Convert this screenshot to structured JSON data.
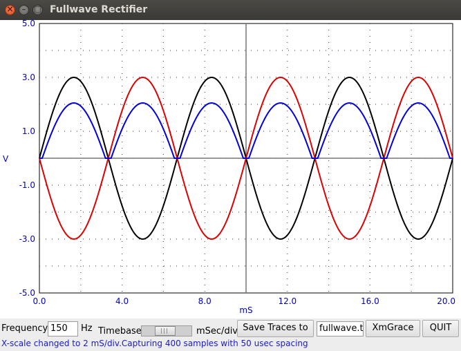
{
  "window": {
    "title": "Fullwave Rectifier",
    "close_glyph": "×",
    "min_glyph": "–",
    "max_glyph": "□"
  },
  "chart_data": {
    "type": "line",
    "xlabel": "mS",
    "ylabel": "V",
    "xlim": [
      0,
      20
    ],
    "ylim": [
      -5,
      5
    ],
    "x_ticks": [
      "0.0",
      "4.0",
      "8.0",
      "12.0",
      "16.0",
      "20.0"
    ],
    "y_ticks": [
      "5.0",
      "3.0",
      "1.0",
      "-1.0",
      "-3.0",
      "-5.0"
    ],
    "grid": "dotted",
    "frequency_hz": 150,
    "series": [
      {
        "color": "#000000",
        "amplitude": 3.0,
        "shape": "sine",
        "period_ms": 6.667
      },
      {
        "color": "#dd0000",
        "amplitude": -3.0,
        "shape": "sine",
        "period_ms": 6.667
      },
      {
        "color": "#0000dd",
        "amplitude": 2.35,
        "shape": "rectified",
        "period_ms": 6.667
      }
    ],
    "axis_color": "#0000cc"
  },
  "controls": {
    "frequency_label": "Frequency",
    "frequency_value": "150",
    "hz_label": "Hz",
    "timebase_label": "Timebase",
    "timebase_unit": "mSec/div",
    "save_button": "Save Traces to",
    "filename_value": "fullwave.txt",
    "xmgrace_button": "XmGrace",
    "quit_button": "QUIT"
  },
  "status": "X-scale changed to 2 mS/div.Capturing 400 samples with 50 usec spacing"
}
